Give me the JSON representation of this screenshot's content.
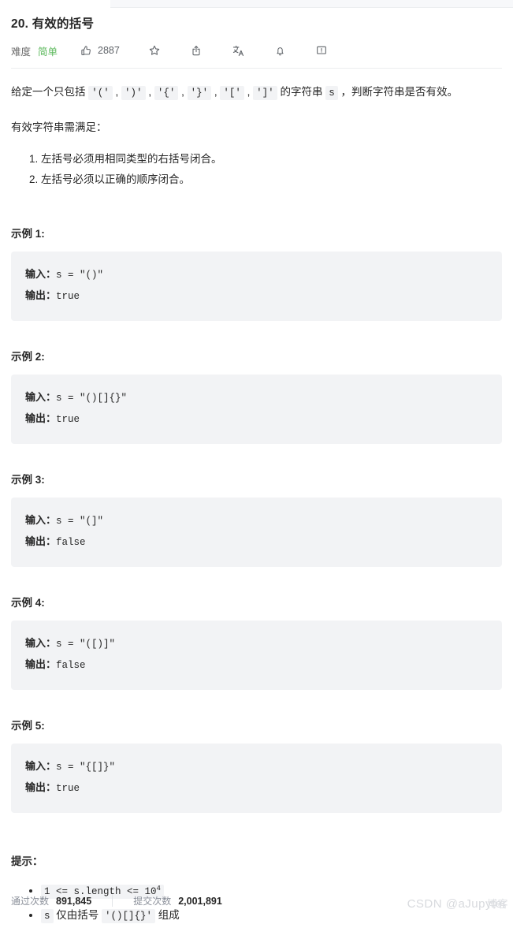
{
  "problem": {
    "title": "20. 有效的括号",
    "difficulty_label": "难度",
    "difficulty_value": "简单",
    "difficulty_color": "#5cb85c",
    "likes": "2887"
  },
  "toolbar": {
    "icons": [
      {
        "name": "thumbs-up-icon",
        "label": "点赞"
      },
      {
        "name": "star-icon",
        "label": "收藏"
      },
      {
        "name": "share-icon",
        "label": "分享"
      },
      {
        "name": "translate-icon",
        "label": "切换语言"
      },
      {
        "name": "bell-icon",
        "label": "订阅"
      },
      {
        "name": "feedback-icon",
        "label": "反馈"
      }
    ]
  },
  "description": {
    "intro_part1": "给定一个只包括 ",
    "token1": "'('",
    "sep1": " , ",
    "token2": "')'",
    "sep2": " , ",
    "token3": "'{'",
    "sep3": " , ",
    "token4": "'}'",
    "sep4": " , ",
    "token5": "'['",
    "sep5": " , ",
    "token6": "']'",
    "intro_part2": " 的字符串 ",
    "token_s": "s",
    "intro_part3": " ，判断字符串是否有效。",
    "requirements_heading": "有效字符串需满足：",
    "rules": [
      "左括号必须用相同类型的右括号闭合。",
      "左括号必须以正确的顺序闭合。"
    ]
  },
  "examples": [
    {
      "heading": "示例 1:",
      "input_label": "输入：",
      "input_value": "s = \"()\"",
      "output_label": "输出：",
      "output_value": "true"
    },
    {
      "heading": "示例 2:",
      "input_label": "输入：",
      "input_value": "s = \"()[]{}\"",
      "output_label": "输出：",
      "output_value": "true"
    },
    {
      "heading": "示例 3:",
      "input_label": "输入：",
      "input_value": "s = \"(]\"",
      "output_label": "输出：",
      "output_value": "false"
    },
    {
      "heading": "示例 4:",
      "input_label": "输入：",
      "input_value": "s = \"([)]\"",
      "output_label": "输出：",
      "output_value": "false"
    },
    {
      "heading": "示例 5:",
      "input_label": "输入：",
      "input_value": "s = \"{[]}\"",
      "output_label": "输出：",
      "output_value": "true"
    }
  ],
  "hints": {
    "heading": "提示：",
    "item1": {
      "code_prefix": "1 <= s.length <= 10",
      "code_exponent": "4"
    },
    "item2": {
      "code_s": "s",
      "text_mid": " 仅由括号 ",
      "code_brackets": "'()[]{}'",
      "text_end": " 组成"
    }
  },
  "footer": {
    "accepted_label": "通过次数",
    "accepted_value": "891,845",
    "submissions_label": "提交次数",
    "submissions_value": "2,001,891",
    "watermark": "CSDN @aJupyter",
    "watermark_overlay": "博客"
  }
}
